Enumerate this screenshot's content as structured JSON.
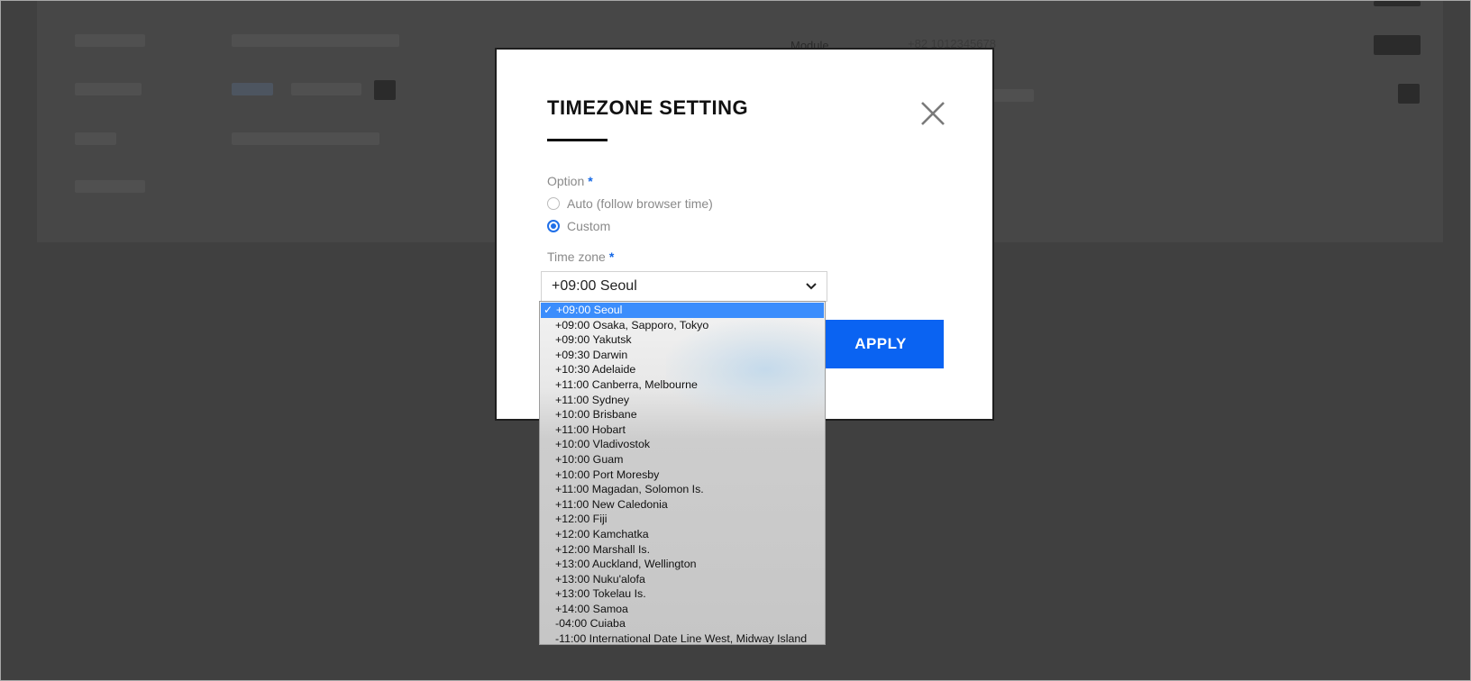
{
  "modal": {
    "title": "TIMEZONE SETTING",
    "option_label": "Option",
    "required_mark": "*",
    "radio_options": [
      {
        "label": "Auto (follow browser time)",
        "checked": false
      },
      {
        "label": "Custom",
        "checked": true
      }
    ],
    "timezone_label": "Time zone",
    "selected_timezone": "+09:00 Seoul",
    "apply_label": "APPLY",
    "close_icon": "close-icon",
    "chevron_icon": "chevron-down-icon"
  },
  "dropdown": {
    "check_glyph": "✓",
    "options": [
      "+09:00 Seoul",
      "+09:00 Osaka, Sapporo, Tokyo",
      "+09:00 Yakutsk",
      "+09:30 Darwin",
      "+10:30 Adelaide",
      "+11:00 Canberra, Melbourne",
      "+11:00 Sydney",
      "+10:00 Brisbane",
      "+11:00 Hobart",
      "+10:00 Vladivostok",
      "+10:00 Guam",
      "+10:00 Port Moresby",
      "+11:00 Magadan, Solomon Is.",
      "+11:00 New Caledonia",
      "+12:00 Fiji",
      "+12:00 Kamchatka",
      "+12:00 Marshall Is.",
      "+13:00 Auckland, Wellington",
      "+13:00 Nuku'alofa",
      "+13:00 Tokelau Is.",
      "+14:00 Samoa",
      "-04:00 Cuiaba",
      "-11:00 International Date Line West, Midway Island"
    ]
  },
  "background": {
    "labels": [
      "Module",
      "+82 1012345678"
    ]
  },
  "colors": {
    "accent": "#0a63f2",
    "overlay": "#404040",
    "selected_option": "#3b8dfc"
  }
}
